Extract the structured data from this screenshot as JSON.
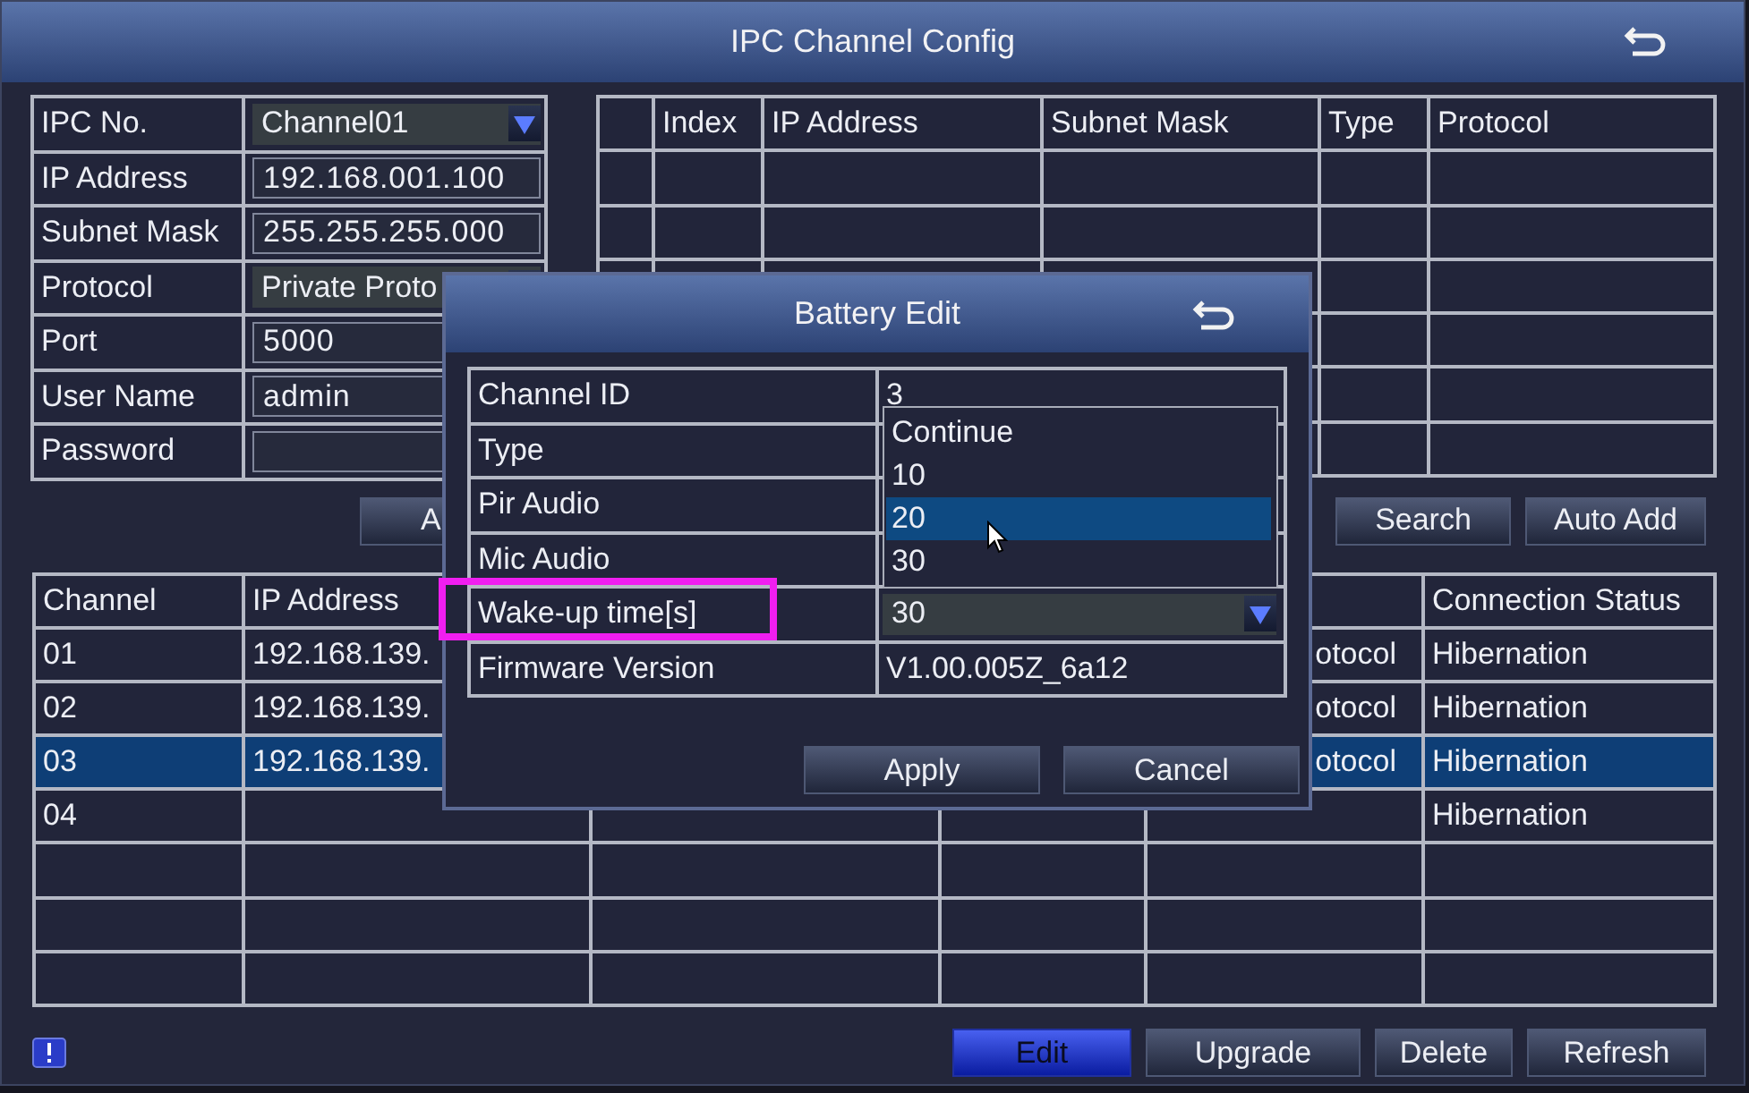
{
  "window": {
    "title": "IPC Channel Config"
  },
  "ipc_form": {
    "fields": [
      {
        "label": "IPC No.",
        "kind": "dropdown",
        "value": "Channel01"
      },
      {
        "label": "IP Address",
        "kind": "text",
        "value": "192.168.001.100"
      },
      {
        "label": "Subnet Mask",
        "kind": "text",
        "value": "255.255.255.000"
      },
      {
        "label": "Protocol",
        "kind": "dropdown",
        "value": "Private Proto"
      },
      {
        "label": "Port",
        "kind": "text",
        "value": "5000"
      },
      {
        "label": "User Name",
        "kind": "text",
        "value": "admin"
      },
      {
        "label": "Password",
        "kind": "text"
      }
    ]
  },
  "search_table": {
    "columns": [
      "Index",
      "IP Address",
      "Subnet Mask",
      "Type",
      "Protocol"
    ]
  },
  "search_buttons": [
    "A",
    "Search",
    "Auto Add"
  ],
  "channel_table": {
    "columns": {
      "channel": "Channel",
      "ip_address": "IP Address",
      "connection_status": "Connection Status"
    },
    "rows": [
      {
        "channel": "01",
        "ip_address": "192.168.139.",
        "column_5": "otocol",
        "connection_status": "Hibernation",
        "selected": false
      },
      {
        "channel": "02",
        "ip_address": "192.168.139.",
        "column_5": "otocol",
        "connection_status": "Hibernation",
        "selected": false
      },
      {
        "channel": "03",
        "ip_address": "192.168.139.",
        "column_5": "otocol",
        "connection_status": "Hibernation",
        "selected": true
      },
      {
        "channel": "04",
        "connection_status": "Hibernation",
        "selected": false
      }
    ]
  },
  "footer_buttons": [
    {
      "label": "Edit",
      "selected": true
    },
    {
      "label": "Upgrade",
      "selected": false
    },
    {
      "label": "Delete",
      "selected": false
    },
    {
      "label": "Refresh",
      "selected": false
    }
  ],
  "battery_dialog": {
    "title": "Battery Edit",
    "fields": [
      {
        "label": "Channel ID",
        "kind": "text",
        "value": "3",
        "highlighted": false
      },
      {
        "label": "Type",
        "kind": "text",
        "highlighted": false
      },
      {
        "label": "Pir Audio",
        "kind": "text",
        "highlighted": false
      },
      {
        "label": "Mic Audio",
        "kind": "text",
        "highlighted": false
      },
      {
        "label": "Wake-up time[s]",
        "kind": "dropdown",
        "value": "30",
        "highlighted": true
      },
      {
        "label": "Firmware Version",
        "kind": "text",
        "value": "V1.00.005Z_6a12",
        "highlighted": false
      }
    ],
    "dropdown_options": [
      {
        "label": "Continue",
        "selected": false
      },
      {
        "label": "10",
        "selected": false
      },
      {
        "label": "20",
        "selected": true
      },
      {
        "label": "30",
        "selected": false
      }
    ],
    "buttons": [
      "Apply",
      "Cancel"
    ]
  }
}
